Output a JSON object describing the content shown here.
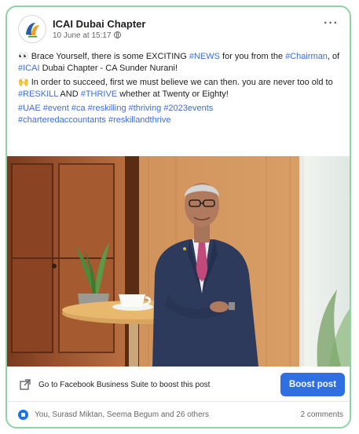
{
  "post": {
    "page_name": "ICAI Dubai Chapter",
    "timestamp": "10 June at 15:17",
    "more_label": "···",
    "paragraph1": {
      "before_1": "Brace Yourself, there is some EXCITING ",
      "tag_1": "#NEWS",
      "mid_1": " for you from the ",
      "tag_2": "#Chairman",
      "mid_2": ", of ",
      "tag_3": "#ICAI",
      "after": " Dubai Chapter - CA Sunder Nurani!"
    },
    "paragraph2": {
      "before": "In order to succeed, first we must believe we can then. you are never too old to ",
      "tag_1": "#RESKILL",
      "mid": " AND ",
      "tag_2": "#THRIVE",
      "after": " whether at Twenty or Eighty!"
    },
    "hashtags_line1": "#UAE #event #ca #reskilling #thriving #2023events",
    "hashtags_line2": "#charteredaccountants #reskillandthrive"
  },
  "footer": {
    "suite_text": "Go to Facebook Business Suite to boost this post",
    "boost_label": "Boost post"
  },
  "reactions": {
    "names": "You, Surasd Miktan, Seema Begum and 26 others",
    "comments": "2 comments"
  },
  "colors": {
    "border": "#8fd3a6",
    "link": "#3b6fd8",
    "button": "#2f6fe0",
    "like": "#1a73e8"
  }
}
